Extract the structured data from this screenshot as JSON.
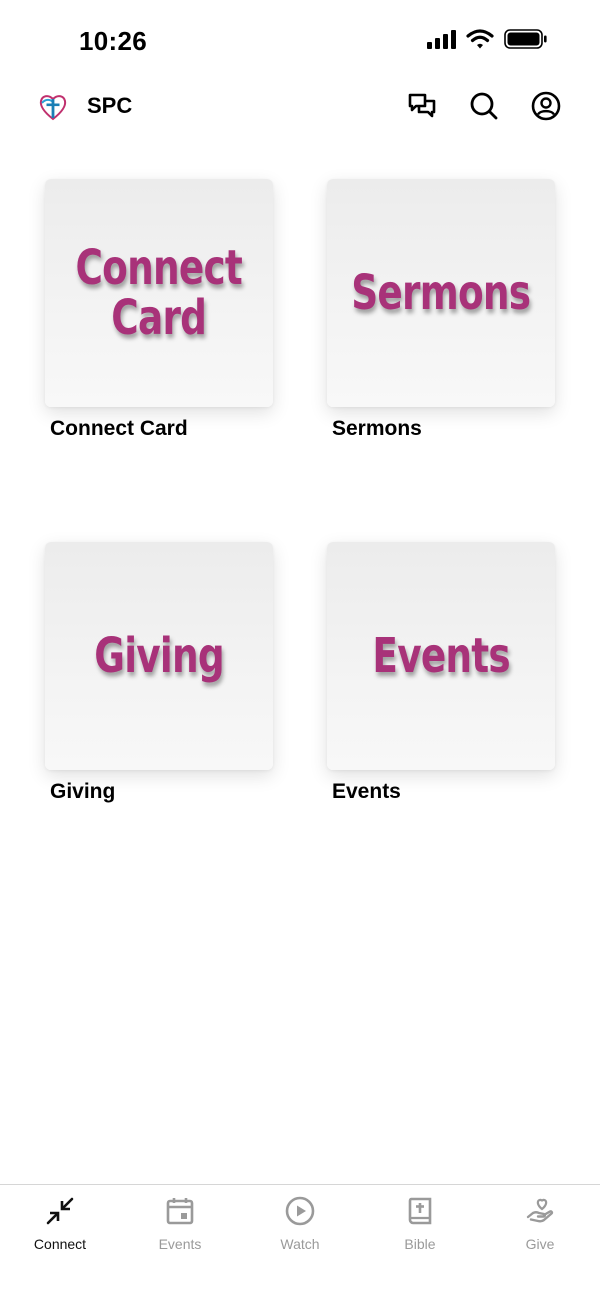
{
  "status_bar": {
    "time": "10:26"
  },
  "header": {
    "title": "SPC"
  },
  "tiles": [
    {
      "image_text": "Connect\nCard",
      "label": "Connect Card"
    },
    {
      "image_text": "Sermons",
      "label": "Sermons"
    },
    {
      "image_text": "Giving",
      "label": "Giving"
    },
    {
      "image_text": "Events",
      "label": "Events"
    }
  ],
  "tabs": [
    {
      "label": "Connect",
      "icon": "connect-arrows-icon",
      "active": true
    },
    {
      "label": "Events",
      "icon": "calendar-icon",
      "active": false
    },
    {
      "label": "Watch",
      "icon": "play-circle-icon",
      "active": false
    },
    {
      "label": "Bible",
      "icon": "bible-icon",
      "active": false
    },
    {
      "label": "Give",
      "icon": "giving-hand-icon",
      "active": false
    }
  ],
  "colors": {
    "accent": "#a83279",
    "active_tab": "#111111",
    "inactive_tab": "#9a9a9a"
  }
}
